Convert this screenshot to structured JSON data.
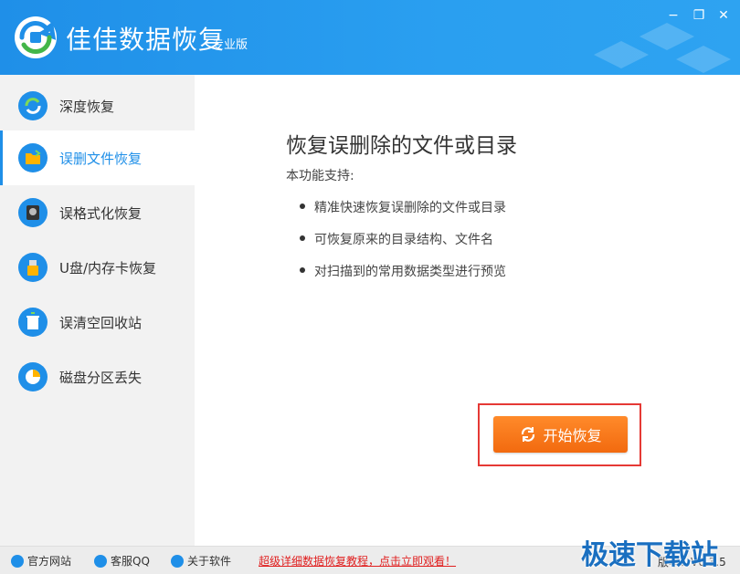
{
  "window": {
    "title": "佳佳数据恢复",
    "edition": "专业版",
    "minimize": "−",
    "restore": "❐",
    "close": "✕"
  },
  "sidebar": {
    "items": [
      {
        "label": "深度恢复",
        "icon": "deep-recover-icon"
      },
      {
        "label": "误删文件恢复",
        "icon": "folder-icon"
      },
      {
        "label": "误格式化恢复",
        "icon": "disk-icon"
      },
      {
        "label": "U盘/内存卡恢复",
        "icon": "usb-icon"
      },
      {
        "label": "误清空回收站",
        "icon": "recycle-bin-icon"
      },
      {
        "label": "磁盘分区丢失",
        "icon": "partition-icon"
      }
    ],
    "active_index": 1
  },
  "main": {
    "heading": "恢复误删除的文件或目录",
    "subheading": "本功能支持:",
    "bullets": [
      "精准快速恢复误删除的文件或目录",
      "可恢复原来的目录结构、文件名",
      "对扫描到的常用数据类型进行预览"
    ],
    "start_button": "开始恢复"
  },
  "footer": {
    "website": "官方网站",
    "qq": "客服QQ",
    "about": "关于软件",
    "promo": "超级详细数据恢复教程，点击立即观看！",
    "version": "版本：V6.3.5"
  },
  "watermark": "极速下载站",
  "colors": {
    "accent": "#1f8fe8",
    "button": "#f26a0f",
    "highlight": "#e53935",
    "promo": "#e02020"
  }
}
